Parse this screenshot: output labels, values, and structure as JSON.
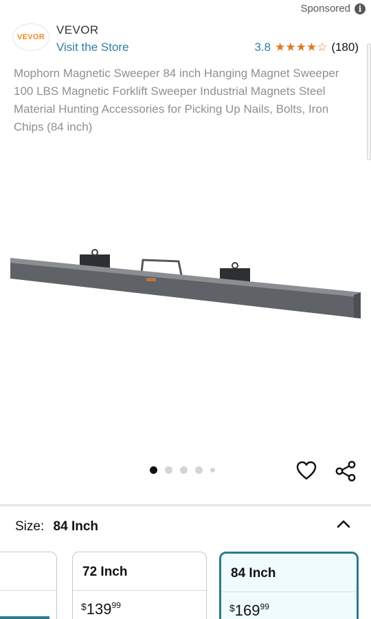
{
  "sponsored": {
    "label": "Sponsored",
    "icon": "info-icon"
  },
  "brand": {
    "logo_text": "VEVOR",
    "name": "VEVOR",
    "visit_store": "Visit the Store",
    "logo_color": "#f08a24"
  },
  "rating": {
    "value": "3.8",
    "stars": "★★★★☆",
    "count": "(180)",
    "star_color": "#de7921"
  },
  "product": {
    "title": "Mophorn Magnetic Sweeper 84 inch Hanging Magnet Sweeper 100 LBS Magnetic Forklift Sweeper Industrial Magnets Steel Material Hunting Accessories for Picking Up Nails, Bolts, Iron Chips (84 inch)",
    "image_icon": "magnetic-sweeper-bar-image"
  },
  "carousel": {
    "total": 5,
    "active_index": 0
  },
  "actions": {
    "favorite_icon": "heart-icon",
    "share_icon": "share-icon"
  },
  "size": {
    "label": "Size:",
    "selected": "84 Inch",
    "options": [
      {
        "label": "72 Inch",
        "currency": "$",
        "whole": "139",
        "fraction": "99"
      },
      {
        "label": "84 Inch",
        "currency": "$",
        "whole": "169",
        "fraction": "99"
      }
    ],
    "selected_color": "#2c7a8c"
  }
}
